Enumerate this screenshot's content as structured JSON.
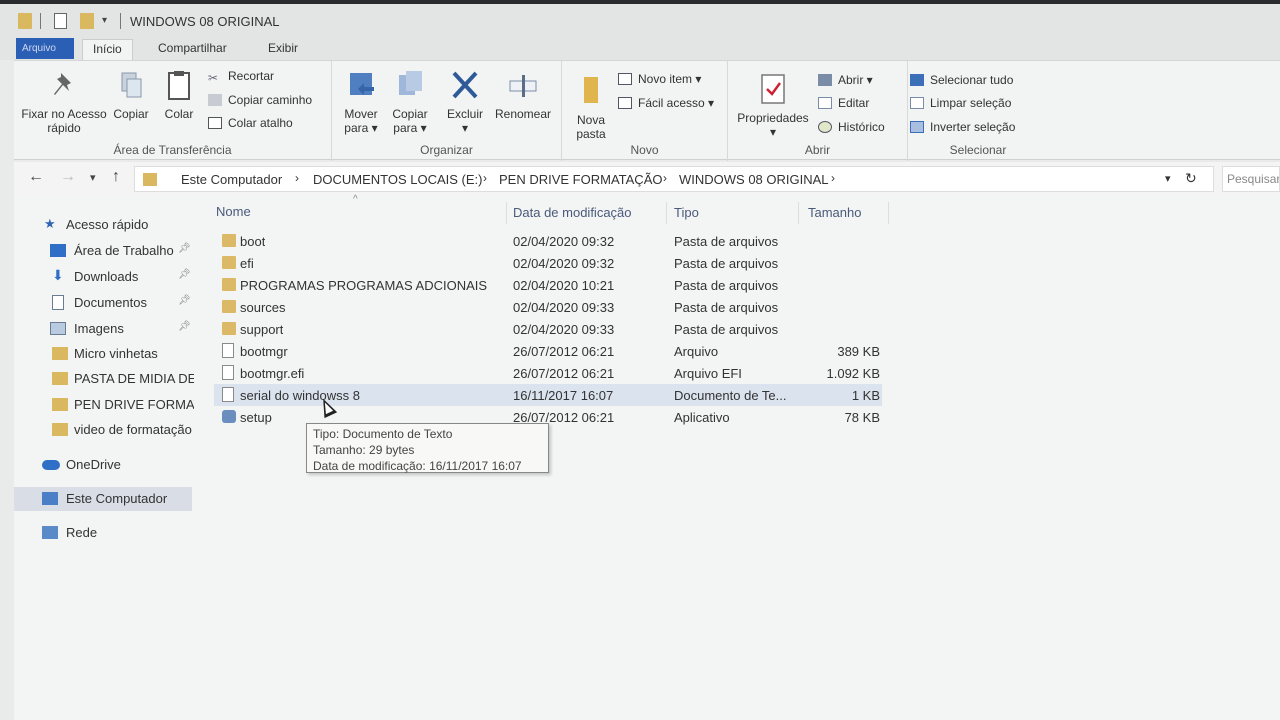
{
  "window": {
    "title": "WINDOWS 08 ORIGINAL"
  },
  "ribbon_tabs": [
    "Arquivo",
    "Início",
    "Compartilhar",
    "Exibir"
  ],
  "ribbon": {
    "clipboard": {
      "label": "Área de Transferência",
      "pin": "Fixar no Acesso rápido",
      "copy": "Copiar",
      "paste": "Colar",
      "cut": "Recortar",
      "copy_path": "Copiar caminho",
      "paste_shortcut": "Colar atalho"
    },
    "organize": {
      "label": "Organizar",
      "move_to": "Mover para",
      "copy_to": "Copiar para",
      "delete": "Excluir",
      "rename": "Renomear"
    },
    "new": {
      "label": "Novo",
      "new_folder": "Nova pasta",
      "new_item": "Novo item",
      "easy_access": "Fácil acesso"
    },
    "open": {
      "label": "Abrir",
      "properties": "Propriedades",
      "open": "Abrir",
      "edit": "Editar",
      "history": "Histórico"
    },
    "select": {
      "label": "Selecionar",
      "select_all": "Selecionar tudo",
      "clear": "Limpar seleção",
      "invert": "Inverter seleção"
    }
  },
  "address": {
    "crumbs": [
      "Este Computador",
      "DOCUMENTOS LOCAIS (E:)",
      "PEN DRIVE FORMATAÇÃO",
      "WINDOWS 08 ORIGINAL"
    ],
    "search_placeholder": "Pesquisar W"
  },
  "sidebar": {
    "quick_access": "Acesso rápido",
    "items": [
      {
        "label": "Área de Trabalho",
        "pinned": true
      },
      {
        "label": "Downloads",
        "pinned": true
      },
      {
        "label": "Documentos",
        "pinned": true
      },
      {
        "label": "Imagens",
        "pinned": true
      },
      {
        "label": "Micro vinhetas",
        "pinned": false
      },
      {
        "label": "PASTA DE MIDIA DE",
        "pinned": false
      },
      {
        "label": "PEN DRIVE FORMAT",
        "pinned": false
      },
      {
        "label": "video de formatação",
        "pinned": false
      }
    ],
    "onedrive": "OneDrive",
    "this_pc": "Este Computador",
    "network": "Rede"
  },
  "columns": {
    "name": "Nome",
    "date": "Data de modificação",
    "type": "Tipo",
    "size": "Tamanho"
  },
  "files": [
    {
      "name": "boot",
      "date": "02/04/2020 09:32",
      "type": "Pasta de arquivos",
      "size": "",
      "icon": "folder-icon"
    },
    {
      "name": "efi",
      "date": "02/04/2020 09:32",
      "type": "Pasta de arquivos",
      "size": "",
      "icon": "folder-icon"
    },
    {
      "name": "PROGRAMAS PROGRAMAS ADCIONAIS",
      "date": "02/04/2020 10:21",
      "type": "Pasta de arquivos",
      "size": "",
      "icon": "folder-icon"
    },
    {
      "name": "sources",
      "date": "02/04/2020 09:33",
      "type": "Pasta de arquivos",
      "size": "",
      "icon": "folder-icon"
    },
    {
      "name": "support",
      "date": "02/04/2020 09:33",
      "type": "Pasta de arquivos",
      "size": "",
      "icon": "folder-icon"
    },
    {
      "name": "bootmgr",
      "date": "26/07/2012 06:21",
      "type": "Arquivo",
      "size": "389 KB",
      "icon": "file-icon"
    },
    {
      "name": "bootmgr.efi",
      "date": "26/07/2012 06:21",
      "type": "Arquivo EFI",
      "size": "1.092 KB",
      "icon": "file-icon"
    },
    {
      "name": "serial do windowss 8",
      "date": "16/11/2017 16:07",
      "type": "Documento de Te...",
      "size": "1 KB",
      "icon": "text-document-icon"
    },
    {
      "name": "setup",
      "date": "26/07/2012 06:21",
      "type": "Aplicativo",
      "size": "78 KB",
      "icon": "setup-app-icon"
    }
  ],
  "tooltip": {
    "type": "Tipo: Documento de Texto",
    "size": "Tamanho: 29 bytes",
    "date": "Data de modificação: 16/11/2017 16:07"
  }
}
